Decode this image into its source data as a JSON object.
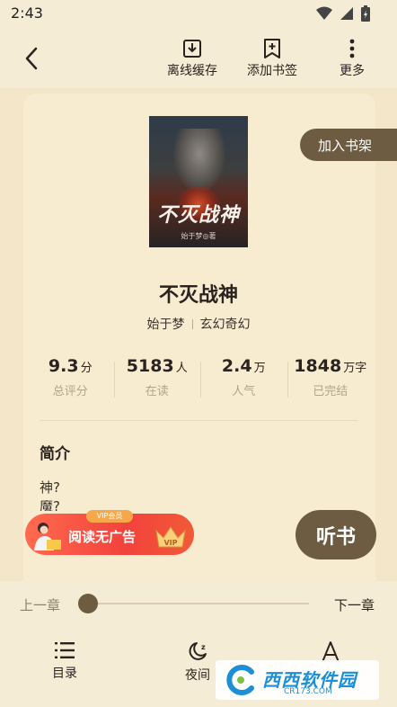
{
  "status_bar": {
    "time": "2:43"
  },
  "header": {
    "actions": [
      {
        "label": "离线缓存",
        "icon": "download-icon"
      },
      {
        "label": "添加书签",
        "icon": "bookmark-add-icon"
      },
      {
        "label": "更多",
        "icon": "more-vertical-icon"
      }
    ]
  },
  "book": {
    "add_shelf": "加入书架",
    "cover": {
      "title": "不灭战神",
      "author": "始于梦◎著"
    },
    "title": "不灭战神",
    "author": "始于梦",
    "category": "玄幻奇幻",
    "stats": [
      {
        "value": "9.3",
        "unit": "分",
        "label": "总评分"
      },
      {
        "value": "5183",
        "unit": "人",
        "label": "在读"
      },
      {
        "value": "2.4",
        "unit": "万",
        "label": "人气"
      },
      {
        "value": "1848",
        "unit": "万字",
        "label": "已完结"
      }
    ],
    "intro": {
      "heading": "简介",
      "line1": "神?",
      "line2": "魔?"
    }
  },
  "promo": {
    "tag": "VIP会员",
    "text": "阅读无广告",
    "badge": "VIP"
  },
  "listen": "听书",
  "chapter_nav": {
    "prev": "上一章",
    "next": "下一章",
    "progress": 0
  },
  "bottom_nav": [
    {
      "label": "目录",
      "icon": "list-icon"
    },
    {
      "label": "夜间",
      "icon": "moon-icon"
    },
    {
      "label": "",
      "icon": "font-icon"
    }
  ],
  "watermark": {
    "main": "西西软件园",
    "sub": "CR173.COM"
  },
  "colors": {
    "accent": "#6d5c42",
    "background": "#f3e6c9",
    "promo": "#f2423c"
  }
}
